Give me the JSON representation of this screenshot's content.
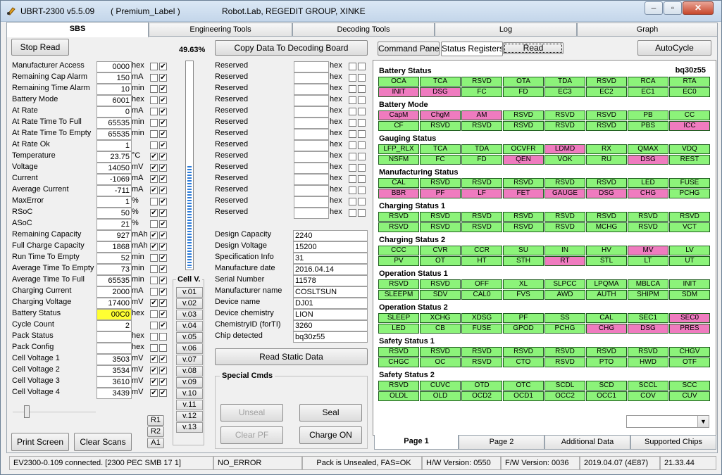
{
  "window": {
    "title": "UBRT-2300 v5.5.09",
    "premium": "( Premium_Label )",
    "org": "Robot.Lab,  REGEDIT GROUP,  XINKE",
    "min": "–",
    "max": "▫",
    "close": "✕"
  },
  "tabs": [
    "SBS",
    "Engineering Tools",
    "Decoding Tools",
    "Log",
    "Graph"
  ],
  "left": {
    "stop_read": "Stop Read",
    "percent": "49.63%",
    "rows": [
      {
        "label": "Manufacturer Access",
        "value": "0000",
        "unit": "hex",
        "c1": "",
        "c2": "✔"
      },
      {
        "label": "Remaining Cap Alarm",
        "value": "150",
        "unit": "mA",
        "c1": "",
        "c2": "✔"
      },
      {
        "label": "Remaining Time Alarm",
        "value": "10",
        "unit": "min",
        "c1": "",
        "c2": "✔"
      },
      {
        "label": "Battery Mode",
        "value": "6001",
        "unit": "hex",
        "c1": "",
        "c2": "✔"
      },
      {
        "label": "At Rate",
        "value": "0",
        "unit": "mA",
        "c1": "",
        "c2": "✔"
      },
      {
        "label": "At Rate Time To Full",
        "value": "65535",
        "unit": "min",
        "c1": "",
        "c2": "✔"
      },
      {
        "label": "At Rate Time To Empty",
        "value": "65535",
        "unit": "min",
        "c1": "",
        "c2": "✔"
      },
      {
        "label": "At Rate Ok",
        "value": "1",
        "unit": "",
        "c1": "",
        "c2": "✔"
      },
      {
        "label": "Temperature",
        "value": "23.75",
        "unit": "°C",
        "c1": "✔",
        "c2": "✔"
      },
      {
        "label": "Voltage",
        "value": "14050",
        "unit": "mV",
        "c1": "✔",
        "c2": "✔"
      },
      {
        "label": "Current",
        "value": "-1069",
        "unit": "mA",
        "c1": "✔",
        "c2": "✔"
      },
      {
        "label": "Average Current",
        "value": "-711",
        "unit": "mA",
        "c1": "✔",
        "c2": "✔"
      },
      {
        "label": "MaxError",
        "value": "1",
        "unit": "%",
        "c1": "",
        "c2": "✔"
      },
      {
        "label": "RSoC",
        "value": "50",
        "unit": "%",
        "c1": "✔",
        "c2": "✔"
      },
      {
        "label": "ASoC",
        "value": "21",
        "unit": "%",
        "c1": "",
        "c2": "✔"
      },
      {
        "label": "Remaining Capacity",
        "value": "927",
        "unit": "mAh",
        "c1": "✔",
        "c2": "✔"
      },
      {
        "label": "Full Charge Capacity",
        "value": "1868",
        "unit": "mAh",
        "c1": "✔",
        "c2": "✔"
      },
      {
        "label": "Run Time To Empty",
        "value": "52",
        "unit": "min",
        "c1": "",
        "c2": "✔"
      },
      {
        "label": "Average Time To Empty",
        "value": "73",
        "unit": "min",
        "c1": "",
        "c2": "✔"
      },
      {
        "label": "Average Time To Full",
        "value": "65535",
        "unit": "min",
        "c1": "",
        "c2": "✔"
      },
      {
        "label": "Charging Current",
        "value": "2000",
        "unit": "mA",
        "c1": "",
        "c2": "✔"
      },
      {
        "label": "Charging Voltage",
        "value": "17400",
        "unit": "mV",
        "c1": "✔",
        "c2": "✔"
      },
      {
        "label": "Battery Status",
        "value": "00C0",
        "unit": "hex",
        "c1": "",
        "c2": "✔",
        "highlight": "#ffff33"
      },
      {
        "label": "Cycle Count",
        "value": "2",
        "unit": "",
        "c1": "",
        "c2": "✔"
      },
      {
        "label": "Pack Status",
        "value": "",
        "unit": "hex",
        "c1": "",
        "c2": ""
      },
      {
        "label": "Pack Config",
        "value": "",
        "unit": "hex",
        "c1": "",
        "c2": ""
      },
      {
        "label": "Cell Voltage 1",
        "value": "3503",
        "unit": "mV",
        "c1": "✔",
        "c2": "✔"
      },
      {
        "label": "Cell Voltage 2",
        "value": "3534",
        "unit": "mV",
        "c1": "✔",
        "c2": "✔"
      },
      {
        "label": "Cell Voltage 3",
        "value": "3610",
        "unit": "mV",
        "c1": "✔",
        "c2": "✔"
      },
      {
        "label": "Cell Voltage 4",
        "value": "3439",
        "unit": "mV",
        "c1": "✔",
        "c2": "✔"
      }
    ],
    "print_screen": "Print Screen",
    "clear_scans": "Clear Scans",
    "r1": "R1",
    "r2": "R2",
    "a1": "A1",
    "cellv_title": "Cell V.",
    "cellv": [
      "v.01",
      "v.02",
      "v.03",
      "v.04",
      "v.05",
      "v.06",
      "v.07",
      "v.08",
      "v.09",
      "v.10",
      "v.11",
      "v.12",
      "v.13"
    ],
    "level_fraction": 0.4963
  },
  "middle": {
    "copy_btn": "Copy Data To Decoding Board",
    "reserved_label": "Reserved",
    "reserved_unit": "hex",
    "reserved_count": 14,
    "static": [
      {
        "label": "Design Capacity",
        "value": "2240"
      },
      {
        "label": "Design Voltage",
        "value": "15200"
      },
      {
        "label": "Specification Info",
        "value": "31"
      },
      {
        "label": "Manufacture date",
        "value": "2016.04.14"
      },
      {
        "label": "Serial Number",
        "value": "11578"
      },
      {
        "label": "Manufacturer name",
        "value": "COSLTSUN"
      },
      {
        "label": "Device name",
        "value": "DJ01"
      },
      {
        "label": "Device chemistry",
        "value": "LION"
      },
      {
        "label": "ChemistryID (forTI)",
        "value": "3260"
      },
      {
        "label": "Chip detected",
        "value": "bq30z55"
      }
    ],
    "read_static": "Read Static Data",
    "special_title": "Special Cmds",
    "unseal": "Unseal",
    "seal": "Seal",
    "clear_pf": "Clear PF",
    "charge_on": "Charge ON"
  },
  "right": {
    "command_panel": "Command Panel",
    "status_registers": "Status Registers",
    "read": "Read",
    "autocycle": "AutoCycle",
    "chip": "bq30z55",
    "sections": [
      {
        "title": "Battery Status",
        "rows": [
          [
            "OCA",
            "TCA",
            "RSVD",
            "OTA",
            "TDA",
            "RSVD",
            "RCA",
            "RTA"
          ],
          [
            "INIT",
            "DSG",
            "FC",
            "FD",
            "EC3",
            "EC2",
            "EC1",
            "EC0"
          ]
        ],
        "pink": [
          [],
          [
            0,
            1
          ]
        ]
      },
      {
        "title": "Battery Mode",
        "rows": [
          [
            "CapM",
            "ChgM",
            "AM",
            "RSVD",
            "RSVD",
            "RSVD",
            "PB",
            "CC"
          ],
          [
            "CF",
            "RSVD",
            "RSVD",
            "RSVD",
            "RSVD",
            "RSVD",
            "PBS",
            "ICC"
          ]
        ],
        "pink": [
          [
            0,
            1,
            2
          ],
          [
            7
          ]
        ]
      },
      {
        "title": "Gauging Status",
        "rows": [
          [
            "LFP_RLX",
            "TCA",
            "TDA",
            "OCVFR",
            "LDMD",
            "RX",
            "QMAX",
            "VDQ"
          ],
          [
            "NSFM",
            "FC",
            "FD",
            "QEN",
            "VOK",
            "RU",
            "DSG",
            "REST"
          ]
        ],
        "pink": [
          [
            4
          ],
          [
            3,
            6
          ]
        ]
      },
      {
        "title": "Manufacturing Status",
        "rows": [
          [
            "CAL",
            "RSVD",
            "RSVD",
            "RSVD",
            "RSVD",
            "RSVD",
            "LED",
            "FUSE"
          ],
          [
            "BBR",
            "PF",
            "LF",
            "FET",
            "GAUGE",
            "DSG",
            "CHG",
            "PCHG"
          ]
        ],
        "pink": [
          [],
          [
            0,
            1,
            2,
            3,
            4,
            5,
            6
          ]
        ]
      },
      {
        "title": "Charging Status 1",
        "rows": [
          [
            "RSVD",
            "RSVD",
            "RSVD",
            "RSVD",
            "RSVD",
            "RSVD",
            "RSVD",
            "RSVD"
          ],
          [
            "RSVD",
            "RSVD",
            "RSVD",
            "RSVD",
            "RSVD",
            "MCHG",
            "RSVD",
            "VCT"
          ]
        ],
        "pink": [
          [],
          []
        ]
      },
      {
        "title": "Charging Status 2",
        "rows": [
          [
            "CCC",
            "CVR",
            "CCR",
            "SU",
            "IN",
            "HV",
            "MV",
            "LV"
          ],
          [
            "PV",
            "OT",
            "HT",
            "STH",
            "RT",
            "STL",
            "LT",
            "UT"
          ]
        ],
        "pink": [
          [
            6
          ],
          [
            4
          ]
        ]
      },
      {
        "title": "Operation Status 1",
        "rows": [
          [
            "RSVD",
            "RSVD",
            "OFF",
            "XL",
            "SLPCC",
            "LPQMA",
            "MBLCA",
            "INIT"
          ],
          [
            "SLEEPM",
            "SDV",
            "CAL0",
            "FVS",
            "AWD",
            "AUTH",
            "SHIPM",
            "SDM"
          ]
        ],
        "pink": [
          [],
          []
        ]
      },
      {
        "title": "Operation Status 2",
        "rows": [
          [
            "SLEEP",
            "XCHG",
            "XDSG",
            "PF",
            "SS",
            "CAL",
            "SEC1",
            "SEC0"
          ],
          [
            "LED",
            "CB",
            "FUSE",
            "GPOD",
            "PCHG",
            "CHG",
            "DSG",
            "PRES"
          ]
        ],
        "pink": [
          [
            7
          ],
          [
            5,
            6,
            7
          ]
        ]
      },
      {
        "title": "Safety Status 1",
        "rows": [
          [
            "RSVD",
            "RSVD",
            "RSVD",
            "RSVD",
            "RSVD",
            "RSVD",
            "RSVD",
            "CHGV"
          ],
          [
            "CHGC",
            "OC",
            "RSVD",
            "CTO",
            "RSVD",
            "PTO",
            "HWD",
            "OTF"
          ]
        ],
        "pink": [
          [],
          []
        ]
      },
      {
        "title": "Safety Status 2",
        "rows": [
          [
            "RSVD",
            "CUVC",
            "OTD",
            "OTC",
            "SCDL",
            "SCD",
            "SCCL",
            "SCC"
          ],
          [
            "OLDL",
            "OLD",
            "OCD2",
            "OCD1",
            "OCC2",
            "OCC1",
            "COV",
            "CUV"
          ]
        ],
        "pink": [
          [],
          []
        ]
      }
    ],
    "bottom_tabs": [
      "Page 1",
      "Page 2",
      "Additional Data",
      "Supported Chips"
    ],
    "green": "#8cf37a",
    "pink_color": "#ef7bbf"
  },
  "status": [
    "EV2300-0.109 connected. [2300  PEC  SMB  17 1]",
    "NO_ERROR",
    "Pack is Unsealed, FAS=OK",
    "H/W Version: 0550",
    "F/W Version: 0036",
    "2019.04.07  (4E87)",
    "21.33.44"
  ]
}
